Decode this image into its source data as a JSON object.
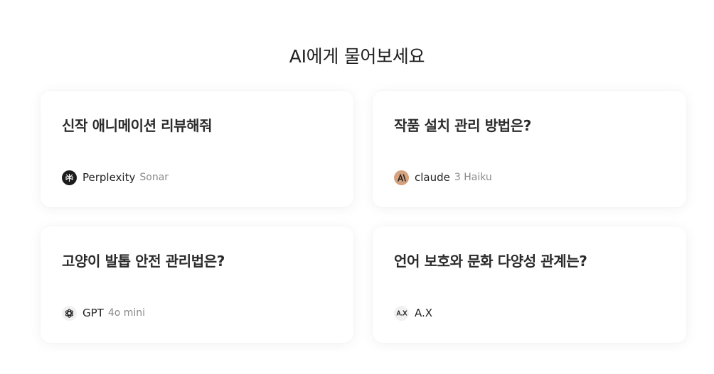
{
  "page": {
    "title": "AI에게 물어보세요"
  },
  "cards": [
    {
      "question": "신작 애니메이션 리뷰해줘",
      "model": "Perplexity",
      "variant": "Sonar",
      "icon": "perplexity-icon"
    },
    {
      "question": "작품 설치 관리 방법은?",
      "model": "claude",
      "variant": "3 Haiku",
      "icon": "claude-icon"
    },
    {
      "question": "고양이 발톱 안전 관리법은?",
      "model": "GPT",
      "variant": "4o mini",
      "icon": "openai-icon"
    },
    {
      "question": "언어 보호와 문화 다양성 관계는?",
      "model": "A.X",
      "variant": "",
      "icon": "ax-icon"
    }
  ],
  "colors": {
    "background": "#ffffff",
    "card": "#ffffff",
    "claude_brand": "#d4a27f",
    "perplexity_brand": "#1c1c1c",
    "muted_text": "#8a8a8a"
  }
}
